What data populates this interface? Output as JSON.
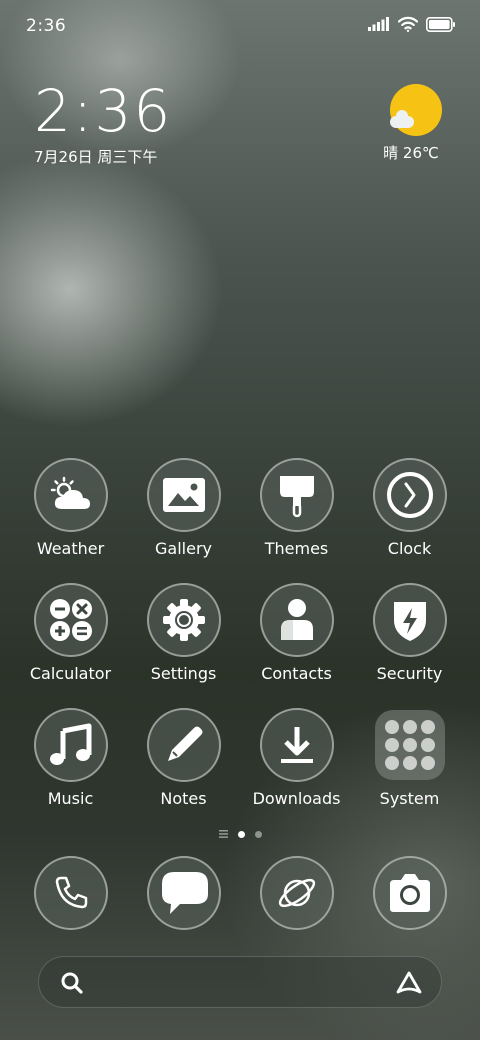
{
  "status_bar": {
    "time": "2:36"
  },
  "clock_widget": {
    "time": "2:36",
    "date": "7月26日 周三下午"
  },
  "weather_widget": {
    "text": "晴 26℃",
    "sun_color": "#f6c315"
  },
  "apps": [
    {
      "label": "Weather",
      "icon": "weather-icon"
    },
    {
      "label": "Gallery",
      "icon": "gallery-icon"
    },
    {
      "label": "Themes",
      "icon": "themes-icon"
    },
    {
      "label": "Clock",
      "icon": "clock-icon"
    },
    {
      "label": "Calculator",
      "icon": "calculator-icon"
    },
    {
      "label": "Settings",
      "icon": "settings-icon"
    },
    {
      "label": "Contacts",
      "icon": "contacts-icon"
    },
    {
      "label": "Security",
      "icon": "security-icon"
    },
    {
      "label": "Music",
      "icon": "music-icon"
    },
    {
      "label": "Notes",
      "icon": "notes-icon"
    },
    {
      "label": "Downloads",
      "icon": "downloads-icon"
    },
    {
      "label": "System",
      "icon": "system-folder-icon"
    }
  ],
  "page_indicator": {
    "pages": 2,
    "current": 1
  },
  "dock": [
    {
      "icon": "phone-icon"
    },
    {
      "icon": "messages-icon"
    },
    {
      "icon": "browser-icon"
    },
    {
      "icon": "camera-icon"
    }
  ]
}
